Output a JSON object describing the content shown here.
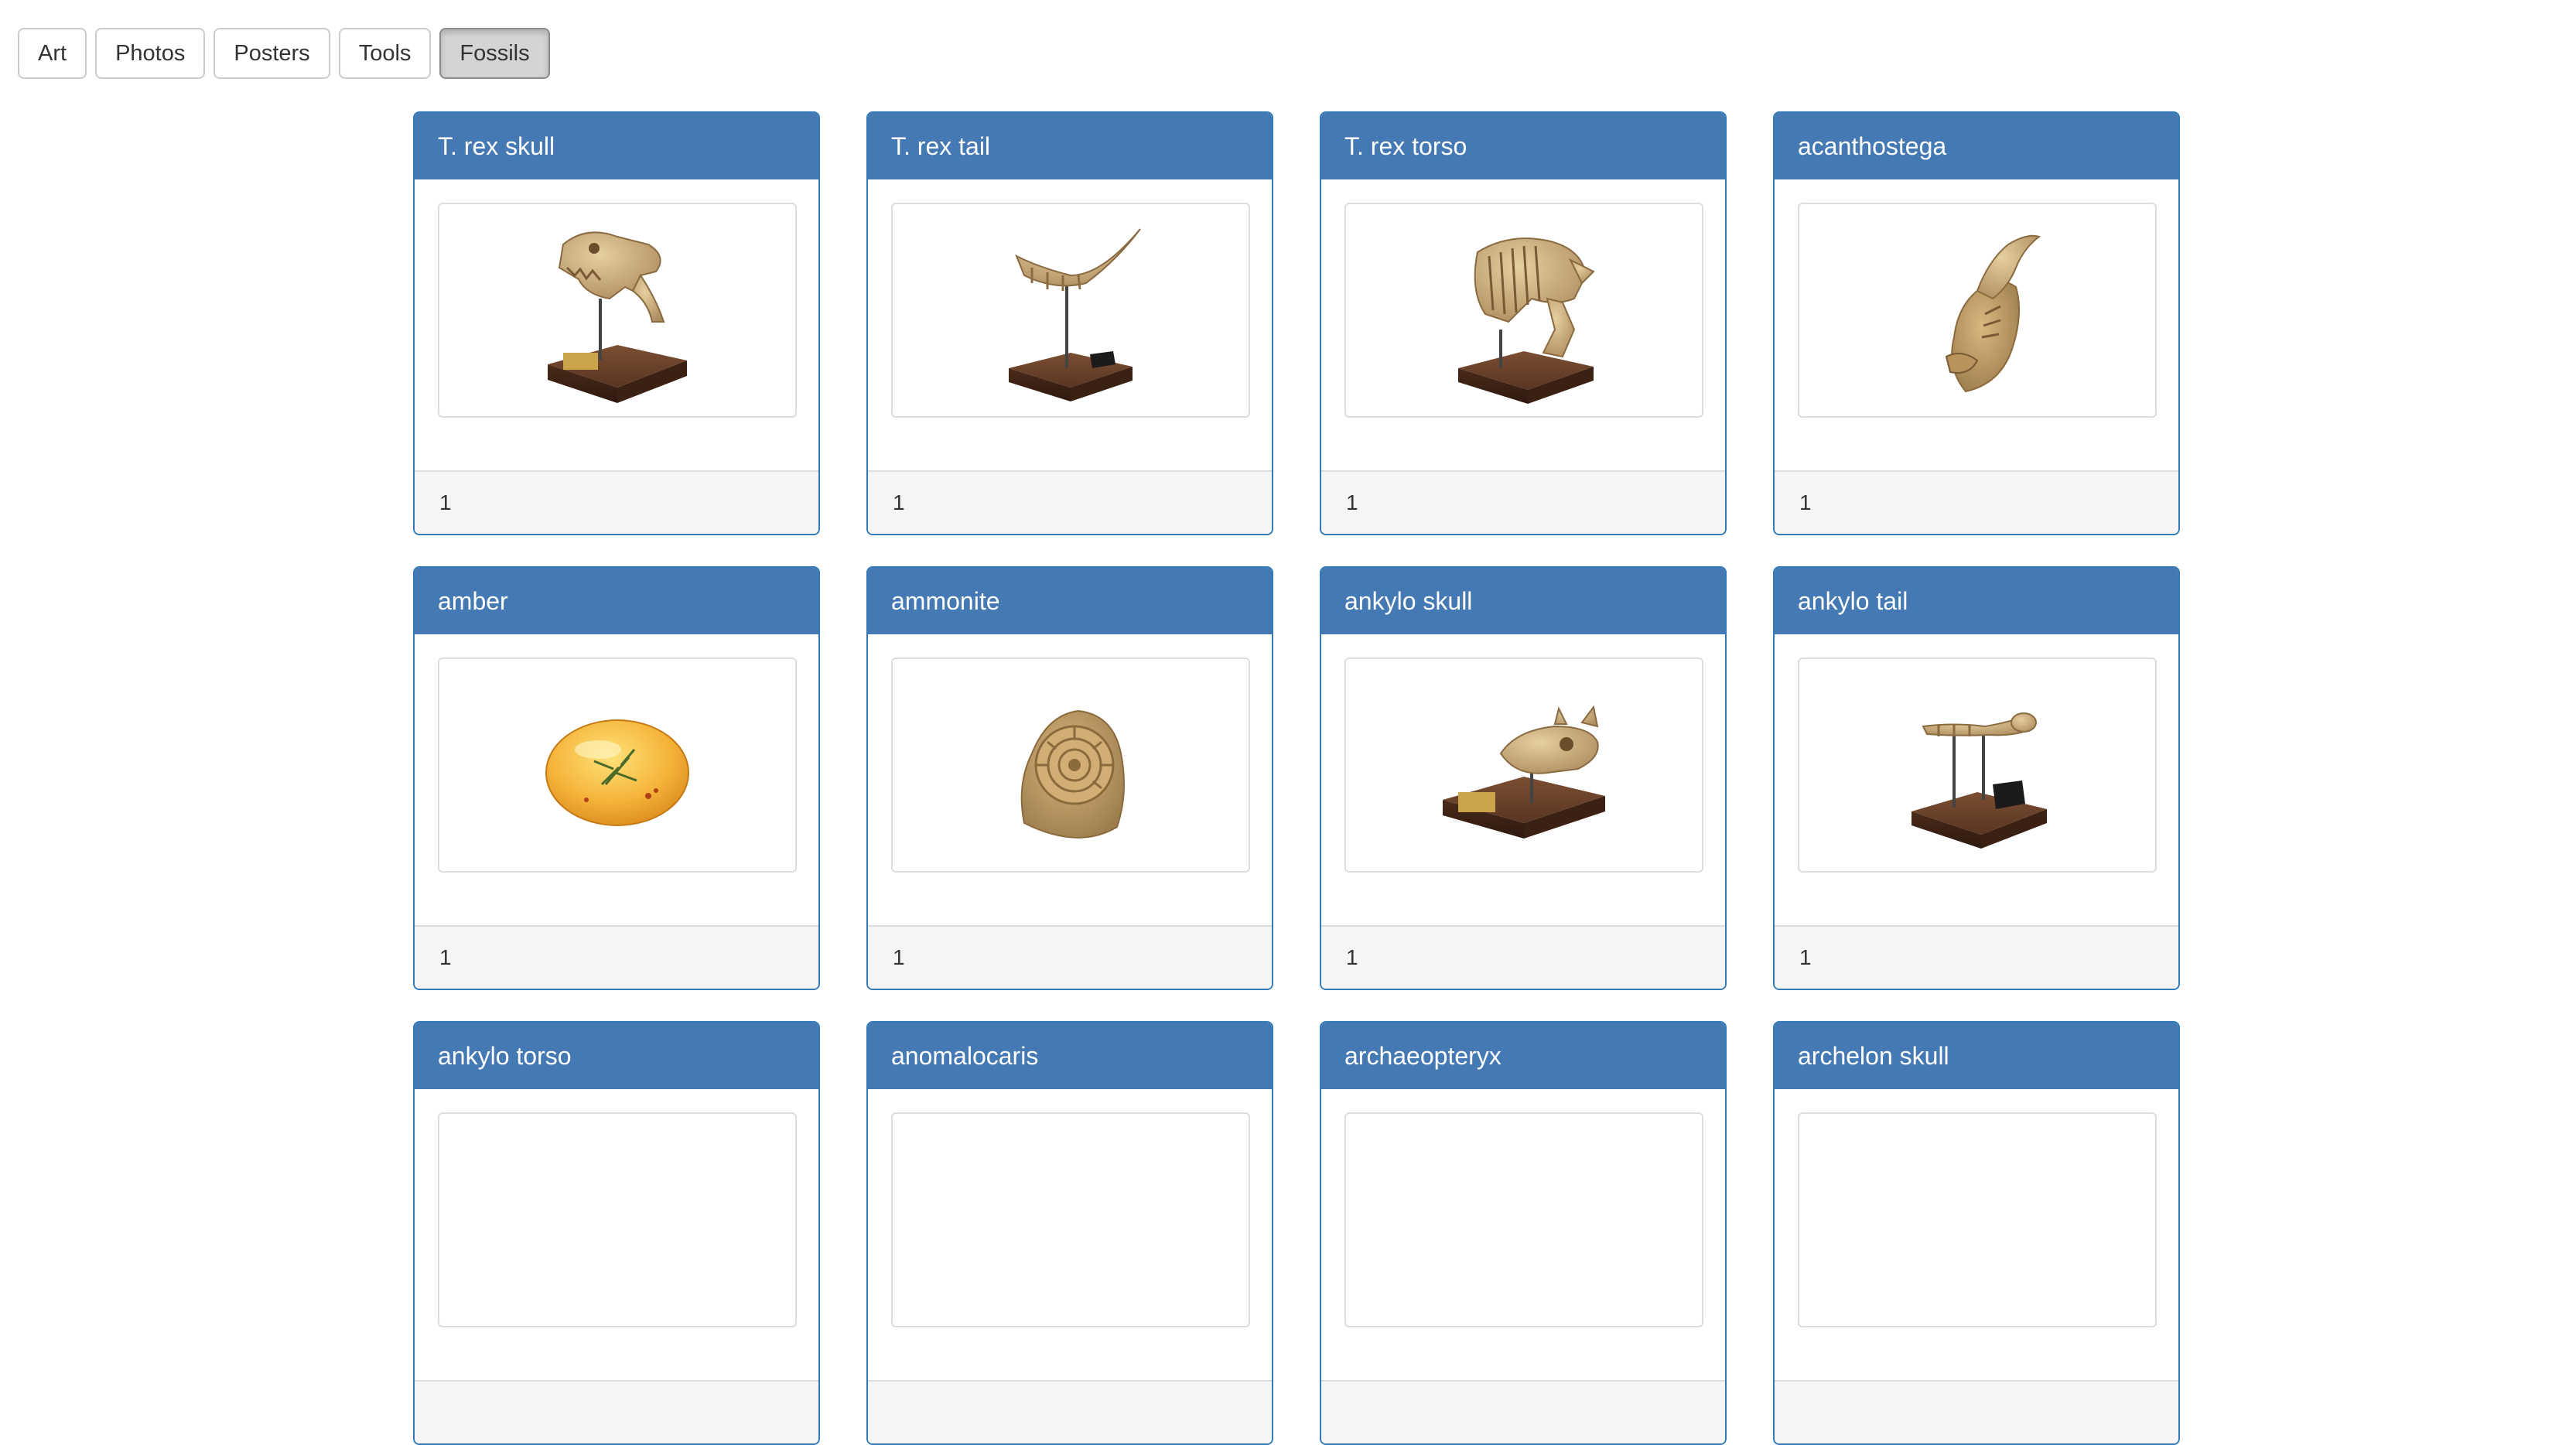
{
  "tabs": [
    {
      "label": "Art",
      "active": false
    },
    {
      "label": "Photos",
      "active": false
    },
    {
      "label": "Posters",
      "active": false
    },
    {
      "label": "Tools",
      "active": false
    },
    {
      "label": "Fossils",
      "active": true
    }
  ],
  "cards": [
    {
      "title": "T. rex skull",
      "count": "1",
      "image": "trex-skull-fossil-icon"
    },
    {
      "title": "T. rex tail",
      "count": "1",
      "image": "trex-tail-fossil-icon"
    },
    {
      "title": "T. rex torso",
      "count": "1",
      "image": "trex-torso-fossil-icon"
    },
    {
      "title": "acanthostega",
      "count": "1",
      "image": "acanthostega-fossil-icon"
    },
    {
      "title": "amber",
      "count": "1",
      "image": "amber-fossil-icon"
    },
    {
      "title": "ammonite",
      "count": "1",
      "image": "ammonite-fossil-icon"
    },
    {
      "title": "ankylo skull",
      "count": "1",
      "image": "ankylo-skull-fossil-icon"
    },
    {
      "title": "ankylo tail",
      "count": "1",
      "image": "ankylo-tail-fossil-icon"
    },
    {
      "title": "ankylo torso",
      "count": "",
      "image": ""
    },
    {
      "title": "anomalocaris",
      "count": "",
      "image": ""
    },
    {
      "title": "archaeopteryx",
      "count": "",
      "image": ""
    },
    {
      "title": "archelon skull",
      "count": "",
      "image": ""
    }
  ],
  "colors": {
    "card_header": "#4479b4",
    "card_border": "#337ab7",
    "card_footer": "#f5f5f5",
    "active_tab": "#d4d4d4"
  }
}
